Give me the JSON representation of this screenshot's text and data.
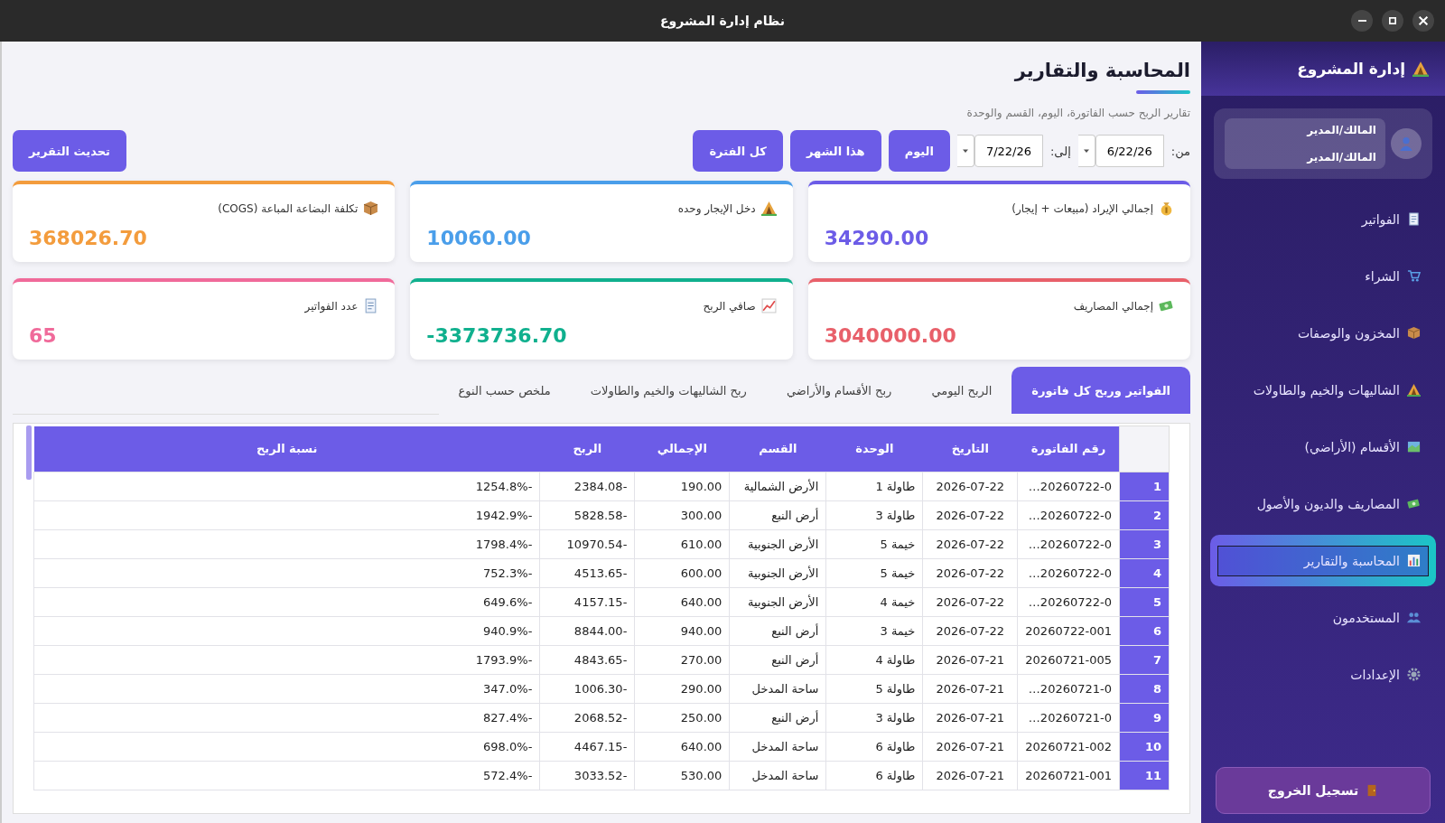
{
  "window": {
    "title": "نظام إدارة المشروع"
  },
  "sidebar": {
    "title": "إدارة المشروع",
    "user": {
      "name": "المالك/المدير",
      "role": "المالك/المدير"
    },
    "items": [
      {
        "label": "الفواتير",
        "selected": false
      },
      {
        "label": "الشراء",
        "selected": false
      },
      {
        "label": "المخزون والوصفات",
        "selected": false
      },
      {
        "label": "الشاليهات والخيم والطاولات",
        "selected": false
      },
      {
        "label": "الأقسام (الأراضي)",
        "selected": false
      },
      {
        "label": "المصاريف والديون والأصول",
        "selected": false
      },
      {
        "label": "المحاسبة والتقارير",
        "selected": true
      },
      {
        "label": "المستخدمون",
        "selected": false
      },
      {
        "label": "الإعدادات",
        "selected": false
      }
    ],
    "logout": "تسجيل الخروج"
  },
  "page": {
    "title": "المحاسبة والتقارير",
    "subtitle": "تقارير الربح حسب الفاتورة، اليوم، القسم والوحدة",
    "filter": {
      "from_label": "من:",
      "from_value": "6/22/26",
      "to_label": "إلى:",
      "to_value": "7/22/26"
    },
    "period_buttons": [
      "اليوم",
      "هذا الشهر",
      "كل الفترة"
    ],
    "refresh_button": "تحديث التقرير"
  },
  "cards": [
    {
      "label": "إجمالي الإيراد (مبيعات + إيجار)",
      "value": "34290.00",
      "color": "#6c5ce7"
    },
    {
      "label": "دخل الإيجار وحده",
      "value": "10060.00",
      "color": "#4a9eea"
    },
    {
      "label": "تكلفة البضاعة المباعة (COGS)",
      "value": "368026.70",
      "color": "#f39c3d"
    },
    {
      "label": "إجمالي المصاريف",
      "value": "3040000.00",
      "color": "#e8606a"
    },
    {
      "label": "صافي الربح",
      "value": "-3373736.70",
      "color": "#10b08e"
    },
    {
      "label": "عدد الفواتير",
      "value": "65",
      "color": "#f06a9a"
    }
  ],
  "tabs": [
    {
      "label": "الفواتير وربح كل فاتورة",
      "selected": true
    },
    {
      "label": "الربح اليومي",
      "selected": false
    },
    {
      "label": "ربح الأقسام والأراضي",
      "selected": false
    },
    {
      "label": "ربح الشاليهات والخيم والطاولات",
      "selected": false
    },
    {
      "label": "ملخص حسب النوع",
      "selected": false
    }
  ],
  "table": {
    "columns": [
      "رقم الفاتورة",
      "التاريخ",
      "الوحدة",
      "القسم",
      "الإجمالي",
      "الربح",
      "نسبة الربح"
    ],
    "rows": [
      {
        "number": "1",
        "cells": [
          "20260722-0…",
          "2026-07-22",
          "طاولة 1",
          "الأرض الشمالية",
          "190.00",
          "-2384.08",
          "-1254.8%"
        ]
      },
      {
        "number": "2",
        "cells": [
          "20260722-0…",
          "2026-07-22",
          "طاولة 3",
          "أرض النبع",
          "300.00",
          "-5828.58",
          "-1942.9%"
        ]
      },
      {
        "number": "3",
        "cells": [
          "20260722-0…",
          "2026-07-22",
          "خيمة 5",
          "الأرض الجنوبية",
          "610.00",
          "-10970.54",
          "-1798.4%"
        ]
      },
      {
        "number": "4",
        "cells": [
          "20260722-0…",
          "2026-07-22",
          "خيمة 5",
          "الأرض الجنوبية",
          "600.00",
          "-4513.65",
          "-752.3%"
        ]
      },
      {
        "number": "5",
        "cells": [
          "20260722-0…",
          "2026-07-22",
          "خيمة 4",
          "الأرض الجنوبية",
          "640.00",
          "-4157.15",
          "-649.6%"
        ]
      },
      {
        "number": "6",
        "cells": [
          "20260722-001",
          "2026-07-22",
          "خيمة 3",
          "أرض النبع",
          "940.00",
          "-8844.00",
          "-940.9%"
        ]
      },
      {
        "number": "7",
        "cells": [
          "20260721-005",
          "2026-07-21",
          "طاولة 4",
          "أرض النبع",
          "270.00",
          "-4843.65",
          "-1793.9%"
        ]
      },
      {
        "number": "8",
        "cells": [
          "20260721-0…",
          "2026-07-21",
          "طاولة 5",
          "ساحة المدخل",
          "290.00",
          "-1006.30",
          "-347.0%"
        ]
      },
      {
        "number": "9",
        "cells": [
          "20260721-0…",
          "2026-07-21",
          "طاولة 3",
          "أرض النبع",
          "250.00",
          "-2068.52",
          "-827.4%"
        ]
      },
      {
        "number": "10",
        "cells": [
          "20260721-002",
          "2026-07-21",
          "طاولة 6",
          "ساحة المدخل",
          "640.00",
          "-4467.15",
          "-698.0%"
        ]
      },
      {
        "number": "11",
        "cells": [
          "20260721-001",
          "2026-07-21",
          "طاولة 6",
          "ساحة المدخل",
          "530.00",
          "-3033.52",
          "-572.4%"
        ]
      }
    ]
  }
}
